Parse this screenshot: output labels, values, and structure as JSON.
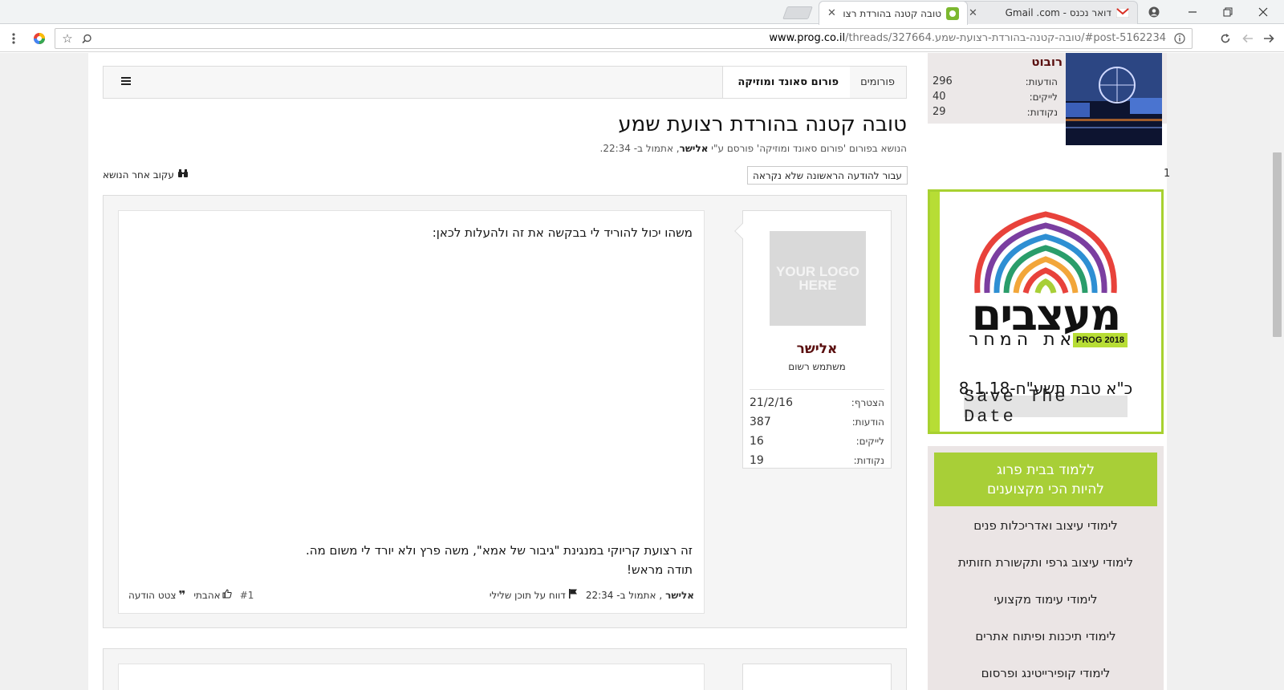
{
  "browser": {
    "tabs": [
      {
        "title": "טובה קטנה בהורדת רצועה",
        "active": true
      },
      {
        "title": "דואר נכנס - Gmail .com",
        "active": false
      }
    ],
    "url_host": "www.prog.co.il",
    "url_path": "/threads/327664.טובה-קטנה-בהורדת-רצועת-שמע/#post-5162234"
  },
  "breadcrumb": {
    "items": [
      "פורומים",
      "פורום סאונד ומוזיקה"
    ]
  },
  "thread": {
    "title": "טובה קטנה בהורדת רצועת שמע",
    "desc_prefix": "הנושא בפורום 'פורום סאונד ומוזיקה' פורסם ע\"י ",
    "desc_author": "אלישר",
    "desc_suffix": ", אתמול ב- 22:34.",
    "unread_button": "עבור להודעה הראשונה שלא נקראה",
    "follow_link": "עקוב אחר הנושא"
  },
  "post": {
    "avatar_text": "YOUR LOGO HERE",
    "author": "אלישר",
    "user_title": "משתמש רשום",
    "stats": [
      {
        "label": "הצטרף:",
        "value": "21/2/16"
      },
      {
        "label": "הודעות:",
        "value": "387"
      },
      {
        "label": "לייקים:",
        "value": "16"
      },
      {
        "label": "נקודות:",
        "value": "19"
      }
    ],
    "body_line1": "משהו יכול להוריד לי בבקשה את זה ולהעלות לכאן:",
    "body_line2": "זה רצועת קריוקי במנגינת \"גיבור של אמא\", משה פרץ ולא יורד לי משום מה.",
    "body_line3": "תודה מראש!",
    "footer_author": "אלישר",
    "footer_time": ", אתמול ב- 22:34",
    "report": "דווח על תוכן שלילי",
    "post_number": "#1",
    "like": "אהבתי",
    "quote": "צטט הודעה"
  },
  "sidebar": {
    "robot_name": "רובוט",
    "robot_stats": [
      {
        "label": "הודעות:",
        "value": "296"
      },
      {
        "label": "לייקים:",
        "value": "40"
      },
      {
        "label": "נקודות:",
        "value": "29"
      }
    ],
    "counter": "1",
    "ad": {
      "title": "מעצבים",
      "subtitle": "את המחר",
      "badge": "PROG 2018",
      "date": "כ\"א טבת תשע\"ח-8.1.18",
      "save_the_date": "Save The Date"
    },
    "courses": {
      "head_line1": "ללמוד בבית פרוג",
      "head_line2": "להיות הכי מקצוענים",
      "items": [
        "לימודי עיצוב ואדריכלות פנים",
        "לימודי עיצוב גרפי ותקשורת חזותית",
        "לימודי עימוד מקצועי",
        "לימודי תיכנות ופיתוח אתרים",
        "לימודי קופירייטינג ופרסום"
      ]
    }
  },
  "colors": {
    "username": "#5a0f0f",
    "accent_green": "#a8cf37"
  }
}
